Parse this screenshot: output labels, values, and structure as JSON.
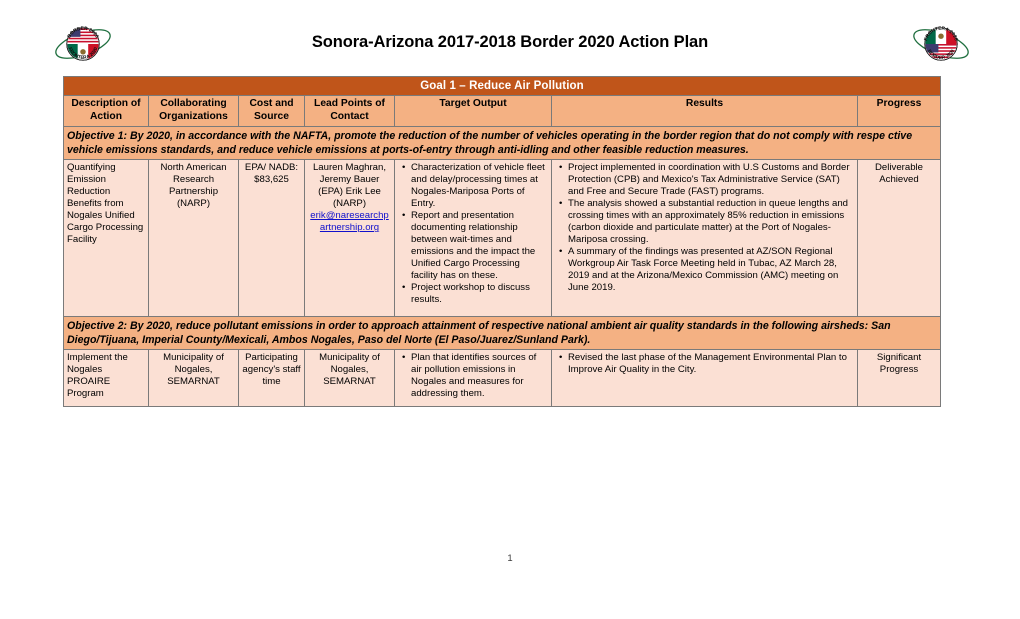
{
  "document": {
    "title": "Sonora-Arizona 2017-2018 Border 2020 Action Plan",
    "page_number": "1",
    "logo_left_name": "border-2020-frontera-2020-logo",
    "logo_right_name": "frontera-2020-border-2020-logo",
    "logo_left_text_top": "BORDER 2020",
    "logo_left_text_bottom": "FRONTERA 2020",
    "logo_right_text_top": "FRONTERA 2020",
    "logo_right_text_bottom": "BORDER 2020"
  },
  "colors": {
    "goal_band": "#C0551A",
    "header_cell": "#F4B183",
    "objective_band": "#F4B183",
    "data_cell": "#FBE0D4",
    "border": "#7a7a7a",
    "link": "#1111CC"
  },
  "table": {
    "goal": "Goal 1 – Reduce Air Pollution",
    "columns": [
      "Description of Action",
      "Collaborating Organizations",
      "Cost and Source",
      "Lead Points of Contact",
      "Target Output",
      "Results",
      "Progress"
    ],
    "objective1": "Objective 1: By 2020, in accordance with the NAFTA, promote the reduction of the number of vehicles operating in the border region that do not comply with respe ctive vehicle emissions standards, and reduce vehicle emissions at ports-of-entry through anti-idling and other feasible reduction measures.",
    "objective2": "Objective 2: By 2020, reduce pollutant emissions in order to approach attainment of respective national ambient air quality standards in the following airsheds: San Diego/Tijuana, Imperial County/Mexicali, Ambos Nogales, Paso del Norte (El Paso/Juarez/Sunland Park).",
    "row1": {
      "description": "Quantifying Emission Reduction Benefits from Nogales Unified Cargo Processing Facility",
      "organizations": "North American Research Partnership (NARP)",
      "cost": "EPA/ NADB: $83,625",
      "contacts_text": "Lauren Maghran, Jeremy Bauer (EPA) Erik Lee (NARP)",
      "contact_email": "erik@naresearchpartnership.org",
      "target_output": [
        "Characterization of vehicle fleet and delay/processing times at Nogales-Mariposa Ports of Entry.",
        "Report and presentation documenting relationship between wait-times and emissions and the impact the Unified Cargo Processing facility has on these.",
        "Project workshop to discuss results."
      ],
      "results": [
        "Project implemented in coordination with U.S Customs and Border Protection (CPB) and Mexico's Tax Administrative Service (SAT) and Free and Secure Trade (FAST) programs.",
        "The analysis showed a substantial reduction in queue lengths and crossing times with an approximately 85% reduction in emissions (carbon dioxide and particulate matter) at the Port of Nogales-Mariposa crossing.",
        "A summary of the findings was presented at AZ/SON Regional Workgroup Air Task Force Meeting held in Tubac, AZ March 28, 2019 and at the Arizona/Mexico Commission (AMC) meeting on June 2019."
      ],
      "progress": "Deliverable Achieved"
    },
    "row2": {
      "description": "Implement the Nogales PROAIRE Program",
      "organizations": "Municipality of Nogales, SEMARNAT",
      "cost": "Participating agency's staff time",
      "contacts_text": "Municipality of Nogales, SEMARNAT",
      "target_output": [
        "Plan that identifies sources of air pollution emissions in Nogales and measures for addressing them."
      ],
      "results": [
        "Revised the last phase of the Management Environmental Plan to Improve Air Quality in the City."
      ],
      "progress": "Significant Progress"
    }
  }
}
